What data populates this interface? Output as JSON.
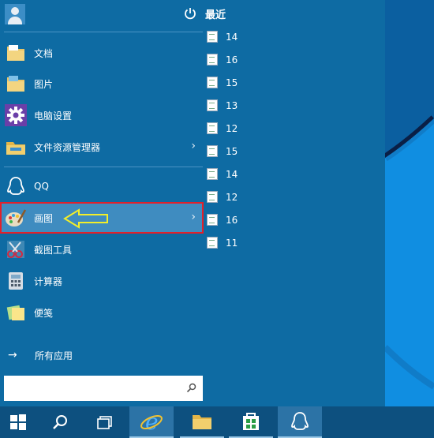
{
  "start_menu": {
    "recent_label": "最近",
    "items": [
      {
        "label": "文档",
        "icon": "folder-documents-icon"
      },
      {
        "label": "图片",
        "icon": "folder-pictures-icon"
      },
      {
        "label": "电脑设置",
        "icon": "gear-icon"
      },
      {
        "label": "文件资源管理器",
        "icon": "file-explorer-icon",
        "chevron": "›"
      },
      {
        "label": "QQ",
        "icon": "qq-penguin-icon"
      },
      {
        "label": "画图",
        "icon": "paint-palette-icon",
        "chevron": "›"
      },
      {
        "label": "截图工具",
        "icon": "snipping-tool-icon"
      },
      {
        "label": "计算器",
        "icon": "calculator-icon"
      },
      {
        "label": "便笺",
        "icon": "sticky-notes-icon"
      }
    ],
    "all_apps": {
      "label": "所有应用",
      "arrow": "→"
    },
    "recent_items": [
      "14",
      "16",
      "15",
      "13",
      "12",
      "15",
      "14",
      "12",
      "16",
      "11"
    ],
    "search_placeholder": ""
  },
  "taskbar": {
    "buttons": [
      "windows-start-icon",
      "search-icon",
      "task-view-icon",
      "internet-explorer-icon",
      "file-explorer-icon",
      "store-icon",
      "qq-icon"
    ]
  },
  "colors": {
    "menu_bg": "#0e6ba3",
    "highlight": "#3f8cc0",
    "highlight_border": "#e2202a",
    "annotation_arrow": "#f2ee2a"
  }
}
